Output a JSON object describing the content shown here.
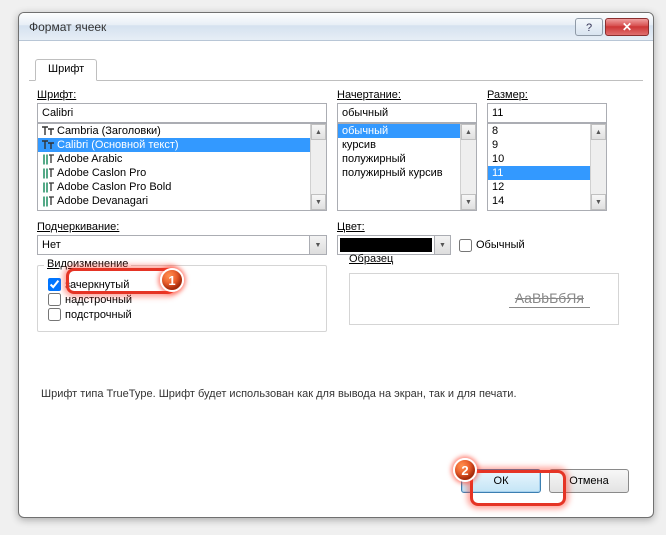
{
  "window": {
    "title": "Формат ячеек"
  },
  "tab": {
    "label": "Шрифт"
  },
  "font": {
    "label": "Шрифт:",
    "value": "Calibri",
    "list": [
      "Cambria (Заголовки)",
      "Calibri (Основной текст)",
      "Adobe Arabic",
      "Adobe Caslon Pro",
      "Adobe Caslon Pro Bold",
      "Adobe Devanagari"
    ],
    "selected_index": 1
  },
  "style": {
    "label": "Начертание:",
    "value": "обычный",
    "list": [
      "обычный",
      "курсив",
      "полужирный",
      "полужирный курсив"
    ],
    "selected_index": 0
  },
  "size": {
    "label": "Размер:",
    "value": "11",
    "list": [
      "8",
      "9",
      "10",
      "11",
      "12",
      "14"
    ],
    "selected_index": 3
  },
  "underline": {
    "label": "Подчеркивание:",
    "value": "Нет"
  },
  "color": {
    "label": "Цвет:",
    "auto_label": "Обычный",
    "swatch": "#000000"
  },
  "effects": {
    "label": "Видоизменение",
    "strikethrough": {
      "label": "зачеркнутый",
      "checked": true
    },
    "superscript": {
      "label": "надстрочный",
      "checked": false
    },
    "subscript": {
      "label": "подстрочный",
      "checked": false
    }
  },
  "sample": {
    "label": "Образец",
    "text": "AaBbБбЯя"
  },
  "description": "Шрифт типа TrueType. Шрифт будет использован как для вывода на экран, так и для печати.",
  "buttons": {
    "ok": "ОК",
    "cancel": "Отмена"
  },
  "badges": {
    "one": "1",
    "two": "2"
  }
}
